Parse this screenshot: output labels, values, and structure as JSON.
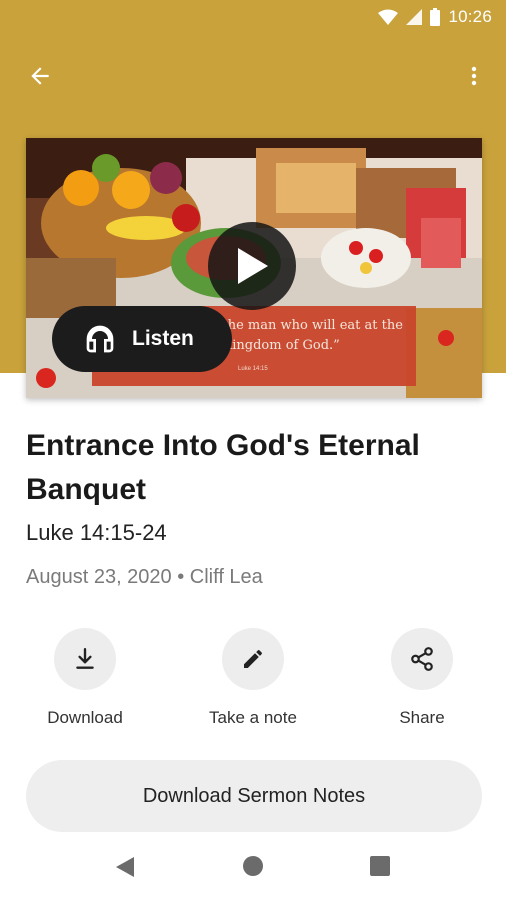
{
  "status_bar": {
    "time": "10:26",
    "icons": [
      "wifi-icon",
      "cell-signal-icon",
      "battery-icon"
    ]
  },
  "app_bar": {
    "back_icon": "arrow-left-icon",
    "more_icon": "more-vertical-icon"
  },
  "colors": {
    "header": "#c9a23c",
    "quote_box": "#c9462b",
    "button_bg": "#eeeeee"
  },
  "hero": {
    "quote": "“Blessed is the man who will eat at the feast in the kingdom of God.”",
    "quote_ref": "Luke 14:15",
    "play_icon": "play-icon",
    "listen": {
      "label": "Listen",
      "icon": "headphones-icon"
    }
  },
  "sermon": {
    "title": "Entrance Into God's Eternal Banquet",
    "scripture": "Luke 14:15-24",
    "meta": "August 23, 2020 • Cliff Lea"
  },
  "actions": [
    {
      "label": "Download",
      "icon": "download-icon"
    },
    {
      "label": "Take a note",
      "icon": "pencil-icon"
    },
    {
      "label": "Share",
      "icon": "share-icon"
    }
  ],
  "notes_button": {
    "label": "Download Sermon Notes"
  },
  "nav_bar": {
    "back": "nav-back-icon",
    "home": "nav-home-icon",
    "recent": "nav-recent-icon"
  }
}
